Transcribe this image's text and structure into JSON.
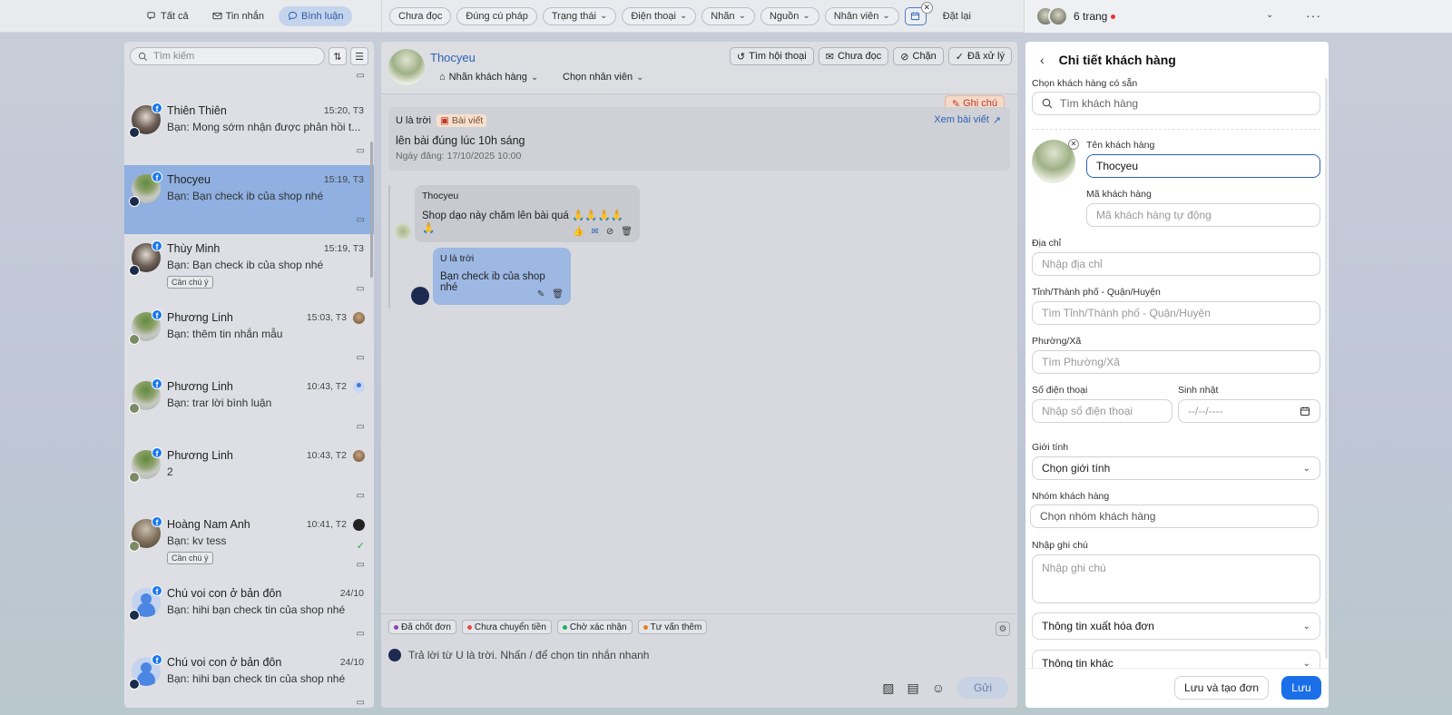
{
  "topbar": {
    "tabs": [
      {
        "label": "Tất cả",
        "active": false
      },
      {
        "label": "Tin nhắn",
        "active": false
      },
      {
        "label": "Bình luận",
        "active": true
      }
    ],
    "filters": [
      "Chưa đọc",
      "Đúng cú pháp",
      "Trạng thái",
      "Điện thoại",
      "Nhãn",
      "Nguồn",
      "Nhân viên"
    ],
    "reset_label": "Đặt lại",
    "pages_label": "6 trang"
  },
  "list": {
    "search_placeholder": "Tìm kiếm",
    "items": [
      {
        "name": "Thiên Thiên",
        "time": "15:20, T3",
        "message": "Bạn: Mong sớm nhận được phản hồi t...",
        "tag": ""
      },
      {
        "name": "Thocyeu",
        "time": "15:19, T3",
        "message": "Bạn: Bạn check ib của shop nhé",
        "tag": ""
      },
      {
        "name": "Thùy Minh",
        "time": "15:19, T3",
        "message": "Bạn: Bạn check ib của shop nhé",
        "tag": "Cần chú ý"
      },
      {
        "name": "Phương Linh",
        "time": "15:03, T3",
        "message": "Bạn: thêm tin nhắn mẫu",
        "tag": ""
      },
      {
        "name": "Phương Linh",
        "time": "10:43, T2",
        "message": "Bạn: trar lời bình luận",
        "tag": ""
      },
      {
        "name": "Phương Linh",
        "time": "10:43, T2",
        "message": "2",
        "tag": ""
      },
      {
        "name": "Hoàng Nam Anh",
        "time": "10:41, T2",
        "message": "Bạn: kv tess",
        "tag": "Cần chú ý"
      },
      {
        "name": "Chú voi con ở bản đôn",
        "time": "24/10",
        "message": "Bạn: hihi bạn check tin của shop nhé",
        "tag": ""
      },
      {
        "name": "Chú voi con ở bản đôn",
        "time": "24/10",
        "message": "Bạn: hihi bạn check tin của shop nhé",
        "tag": ""
      }
    ]
  },
  "chat": {
    "name": "Thocyeu",
    "label_dropdown": "Nhãn khách hàng",
    "staff_dropdown": "Chọn nhân viên",
    "actions": [
      "Tìm hội thoại",
      "Chưa đọc",
      "Chặn",
      "Đã xử lý"
    ],
    "note_button": "Ghi chú",
    "post": {
      "page": "U là trời",
      "badge": "Bài viết",
      "link": "Xem bài viết",
      "title": "lên bài đúng lúc 10h sáng",
      "date": "Ngày đăng: 17/10/2025 10:00"
    },
    "messages": [
      {
        "sender": "Thocyeu",
        "text": "Shop dạo này chăm lên bài quá 🙏🙏🙏🙏🙏"
      },
      {
        "sender": "U là trời",
        "text": "Bạn check ib của shop nhé"
      }
    ],
    "quick_tags": [
      {
        "label": "Đã chốt đơn",
        "color": "#8e44ad"
      },
      {
        "label": "Chưa chuyển tiền",
        "color": "#e74c3c"
      },
      {
        "label": "Chờ xác nhận",
        "color": "#27ae60"
      },
      {
        "label": "Tư vấn thêm",
        "color": "#e67e22"
      }
    ],
    "reply_placeholder": "Trả lời từ U là trời. Nhấn / để chọn tin nhắn nhanh",
    "send_label": "Gửi"
  },
  "panel": {
    "title": "Chi tiết khách hàng",
    "pick_label": "Chọn khách hàng có sẵn",
    "pick_placeholder": "Tìm khách hàng",
    "name_label": "Tên khách hàng",
    "name_value": "Thocyeu",
    "code_label": "Mã khách hàng",
    "code_placeholder": "Mã khách hàng tự động",
    "address_label": "Địa chỉ",
    "address_placeholder": "Nhập địa chỉ",
    "province_label": "Tỉnh/Thành phố - Quận/Huyện",
    "province_placeholder": "Tìm Tỉnh/Thành phố - Quận/Huyện",
    "ward_label": "Phường/Xã",
    "ward_placeholder": "Tìm Phường/Xã",
    "phone_label": "Số điện thoại",
    "phone_placeholder": "Nhập số điện thoại",
    "birthday_label": "Sinh nhật",
    "birthday_placeholder": "--/--/----",
    "gender_label": "Giới tính",
    "gender_value": "Chọn giới tính",
    "group_label": "Nhóm khách hàng",
    "group_placeholder": "Chọn nhóm khách hàng",
    "note_label": "Nhập ghi chú",
    "note_placeholder": "Nhập ghi chú",
    "invoice_section": "Thông tin xuất hóa đơn",
    "other_section": "Thông tin khác",
    "save_create_label": "Lưu và tạo đơn",
    "save_label": "Lưu"
  },
  "colors": {
    "accent": "#1a6fe8",
    "selected_row": "#8fb0e0",
    "facebook": "#1877f2"
  }
}
